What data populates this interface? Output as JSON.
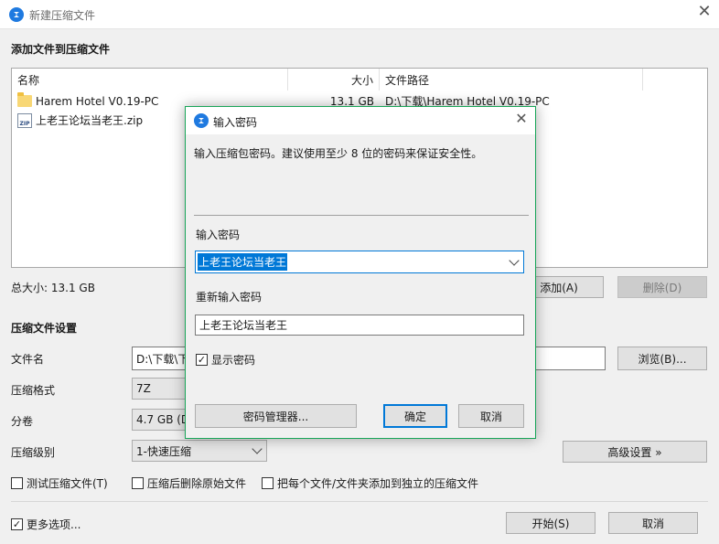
{
  "window": {
    "title": "新建压缩文件",
    "close": "✕"
  },
  "files": {
    "section_title": "添加文件到压缩文件",
    "columns": [
      "名称",
      "大小",
      "文件路径"
    ],
    "rows": [
      {
        "name": "Harem Hotel V0.19-PC",
        "size": "13.1 GB",
        "path": "D:\\下载\\Harem Hotel V0.19-PC",
        "icon": "folder-icon"
      },
      {
        "name": "上老王论坛当老王.zip",
        "size": "",
        "path": "",
        "icon": "zip-file-icon"
      }
    ],
    "total_size": "总大小: 13.1 GB",
    "add_button": "添加(A)",
    "delete_button": "删除(D)"
  },
  "settings": {
    "section_title": "压缩文件设置",
    "filename_label": "文件名",
    "filename_value": "D:\\下载\\下",
    "browse_button": "浏览(B)...",
    "format_label": "压缩格式",
    "format_value": "7Z",
    "volume_label": "分卷",
    "volume_value": "4.7 GB (D",
    "level_label": "压缩级别",
    "level_value": "1-快速压缩",
    "advanced_button": "高级设置 »",
    "test_checkbox": "测试压缩文件(T)",
    "delete_after_checkbox": "压缩后删除原始文件",
    "separate_checkbox": "把每个文件/文件夹添加到独立的压缩文件"
  },
  "footer": {
    "more_options": "更多选项...",
    "more_checked": true,
    "start_button": "开始(S)",
    "cancel_button": "取消"
  },
  "dialog": {
    "title": "输入密码",
    "close": "✕",
    "description": "输入压缩包密码。建议使用至少 8 位的密码来保证安全性。",
    "password_label": "输入密码",
    "password_value": "上老王论坛当老王",
    "repeat_label": "重新输入密码",
    "repeat_value": "上老王论坛当老王",
    "show_password": "显示密码",
    "show_checked": true,
    "manager_button": "密码管理器...",
    "ok_button": "确定",
    "cancel_button": "取消"
  },
  "colors": {
    "accent": "#0078d7",
    "dialog_border": "#18a558",
    "selection": "#0078d7"
  }
}
